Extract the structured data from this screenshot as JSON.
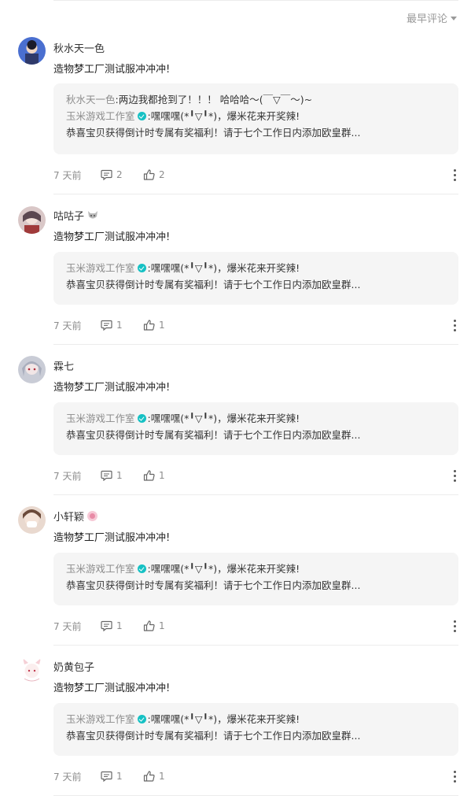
{
  "sort": {
    "label": "最早评论"
  },
  "comments": [
    {
      "username": "秋水天一色",
      "content": "造物梦工厂测试服冲冲冲!",
      "replies": [
        {
          "author": "秋水天一色",
          "separator": ":",
          "text": "两边我都抢到了！！！ 哈哈哈～(￣▽￣～)~",
          "verified": false
        },
        {
          "author": "玉米游戏工作室",
          "separator": ":",
          "text": "嘿嘿嘿(*╹▽╹*)，爆米花来开奖辣!",
          "verified": true
        }
      ],
      "reply_extra": "恭喜宝贝获得倒计时专属有奖福利！请于七个工作日内添加欧皇群...",
      "time": "7 天前",
      "reply_count": "2",
      "like_count": "2"
    },
    {
      "username": "咕咕子",
      "content": "造物梦工厂测试服冲冲冲!",
      "replies": [
        {
          "author": "玉米游戏工作室",
          "separator": ":",
          "text": "嘿嘿嘿(*╹▽╹*)，爆米花来开奖辣!",
          "verified": true
        }
      ],
      "reply_extra": "恭喜宝贝获得倒计时专属有奖福利！请于七个工作日内添加欧皇群...",
      "time": "7 天前",
      "reply_count": "1",
      "like_count": "1"
    },
    {
      "username": "霖七",
      "content": "造物梦工厂测试服冲冲冲!",
      "replies": [
        {
          "author": "玉米游戏工作室",
          "separator": ":",
          "text": "嘿嘿嘿(*╹▽╹*)，爆米花来开奖辣!",
          "verified": true
        }
      ],
      "reply_extra": "恭喜宝贝获得倒计时专属有奖福利！请于七个工作日内添加欧皇群...",
      "time": "7 天前",
      "reply_count": "1",
      "like_count": "1"
    },
    {
      "username": "小轩颖",
      "content": "造物梦工厂测试服冲冲冲!",
      "replies": [
        {
          "author": "玉米游戏工作室",
          "separator": ":",
          "text": "嘿嘿嘿(*╹▽╹*)，爆米花来开奖辣!",
          "verified": true
        }
      ],
      "reply_extra": "恭喜宝贝获得倒计时专属有奖福利！请于七个工作日内添加欧皇群...",
      "time": "7 天前",
      "reply_count": "1",
      "like_count": "1"
    },
    {
      "username": "奶黄包子",
      "content": "造物梦工厂测试服冲冲冲!",
      "replies": [
        {
          "author": "玉米游戏工作室",
          "separator": ":",
          "text": "嘿嘿嘿(*╹▽╹*)，爆米花来开奖辣!",
          "verified": true
        }
      ],
      "reply_extra": "恭喜宝贝获得倒计时专属有奖福利！请于七个工作日内添加欧皇群...",
      "time": "7 天前",
      "reply_count": "1",
      "like_count": "1"
    }
  ],
  "colors": {
    "verified": "#16c1c4",
    "reply_bg": "#f5f5f5",
    "meta": "#8c8c8c"
  },
  "icons": {
    "comment": "comment-icon",
    "like": "thumbs-up-icon",
    "more": "more-vertical-icon",
    "sort": "caret-down-icon"
  }
}
